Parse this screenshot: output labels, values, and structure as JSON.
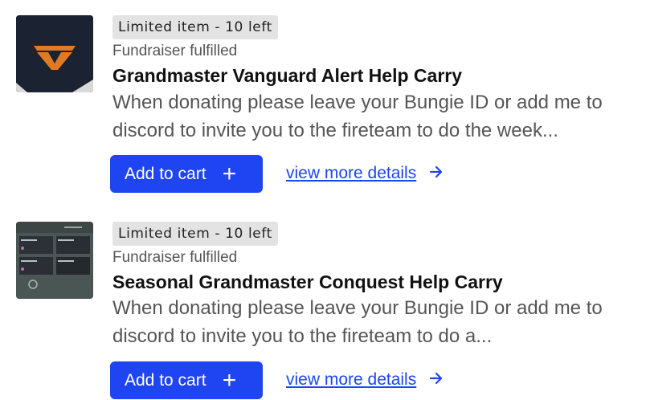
{
  "items": [
    {
      "badge": "Limited item - 10 left",
      "status": "Fundraiser fulfilled",
      "title": "Grandmaster Vanguard Alert Help Carry",
      "description": "When donating please leave your Bungie ID or add me to discord to invite you to the fireteam to do the week...",
      "add_to_cart": "Add to cart",
      "details_link": "view more details",
      "thumbnail": "vanguard-emblem"
    },
    {
      "badge": "Limited item - 10 left",
      "status": "Fundraiser fulfilled",
      "title": "Seasonal Grandmaster Conquest Help Carry",
      "description": "When donating please leave your Bungie ID or add me to discord to invite you to the fireteam to do a...",
      "add_to_cart": "Add to cart",
      "details_link": "view more details",
      "thumbnail": "game-menu-screenshot"
    }
  ],
  "icons": {
    "plus": "plus-icon",
    "arrow": "arrow-right-icon"
  },
  "colors": {
    "accent": "#1f45f2",
    "badge_bg": "#e3e3e3",
    "muted_text": "#555555"
  }
}
